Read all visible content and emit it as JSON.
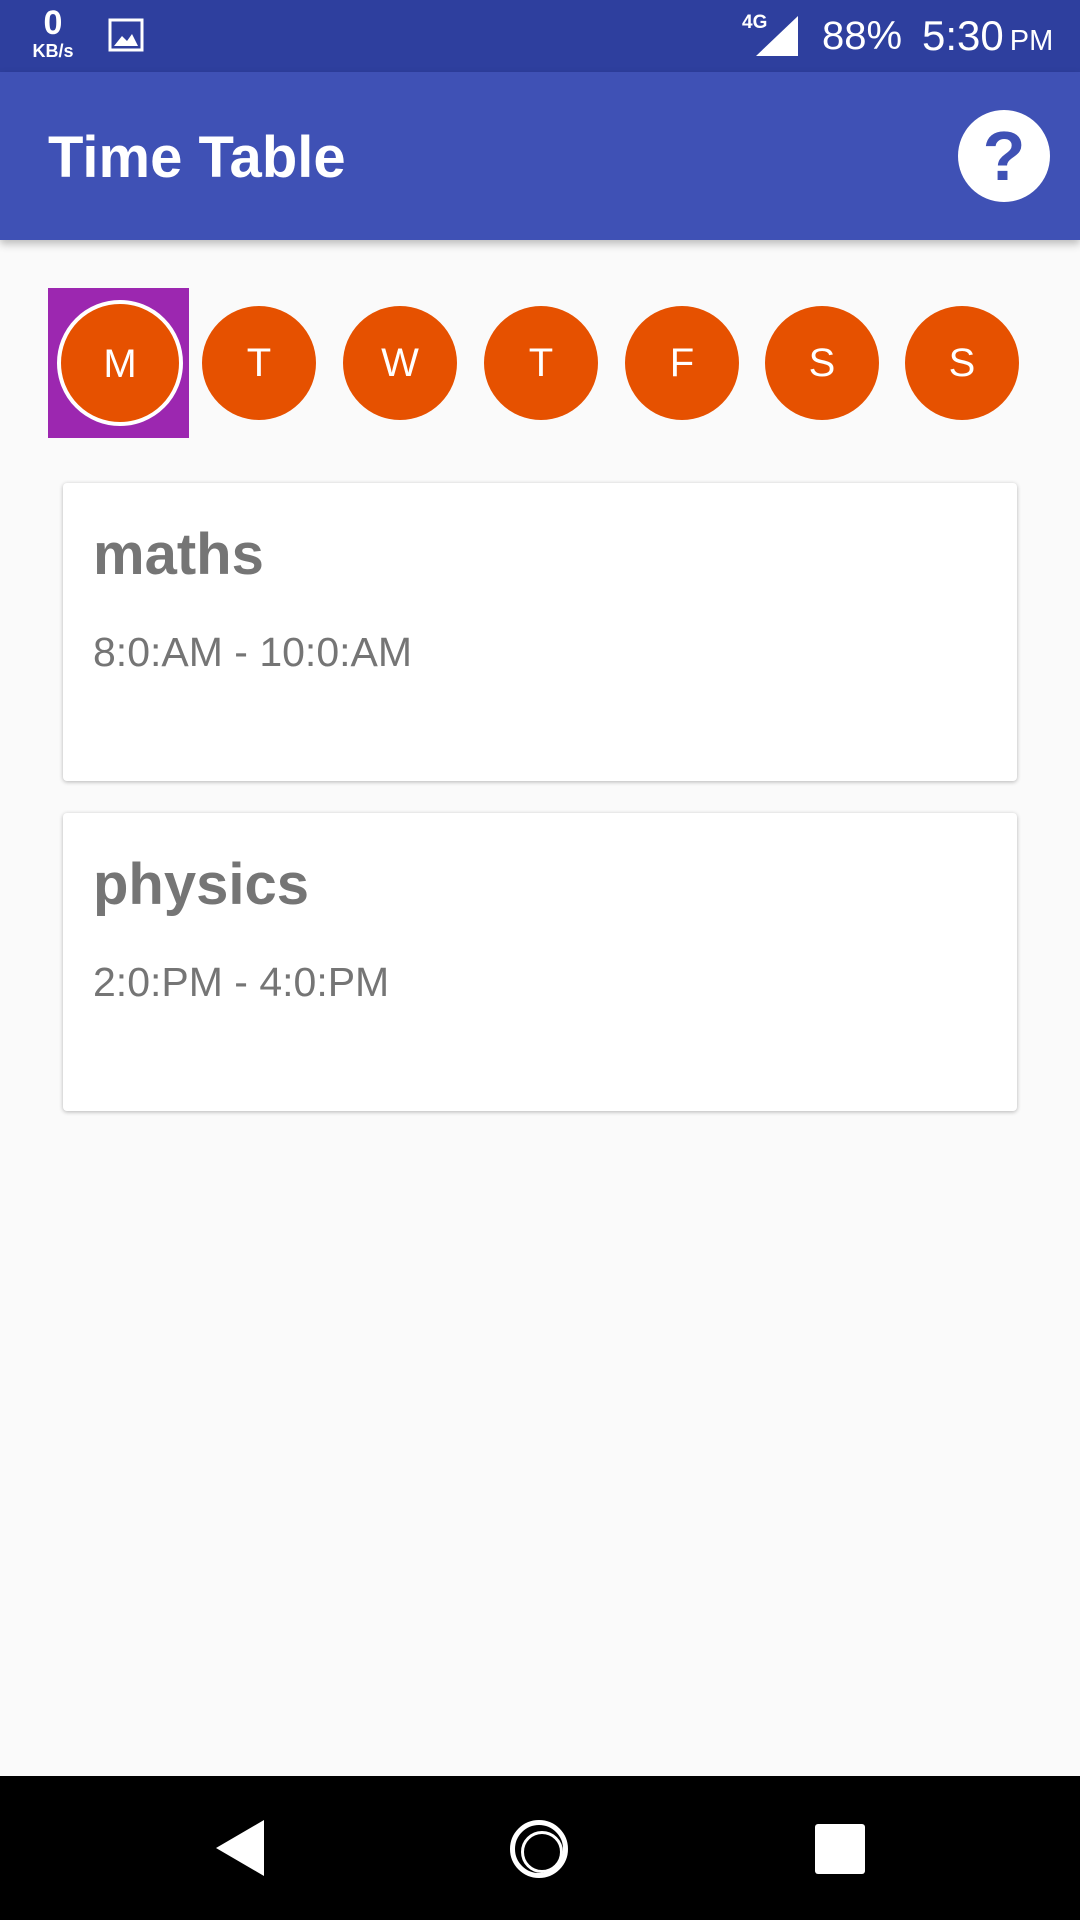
{
  "status_bar": {
    "net_speed_value": "0",
    "net_speed_unit": "KB/s",
    "network_type": "4G",
    "battery": "88%",
    "time": "5:30",
    "ampm": "PM",
    "icons": [
      "gallery-icon",
      "signal-icon"
    ]
  },
  "app_bar": {
    "title": "Time Table",
    "help_icon": "help-icon",
    "help_label": "?"
  },
  "days": {
    "selected_index": 0,
    "items": [
      "M",
      "T",
      "W",
      "T",
      "F",
      "S",
      "S"
    ]
  },
  "schedule": [
    {
      "subject": "maths",
      "time": "8:0:AM - 10:0:AM"
    },
    {
      "subject": "physics",
      "time": "2:0:PM - 4:0:PM"
    }
  ],
  "nav_bar": {
    "icons": [
      "back-icon",
      "home-icon",
      "recents-icon"
    ]
  },
  "colors": {
    "status_bar": "#2e3f9e",
    "app_bar": "#3f51b5",
    "day_circle": "#e65100",
    "day_selected_bg": "#9c27b0",
    "card_text": "#757575"
  }
}
